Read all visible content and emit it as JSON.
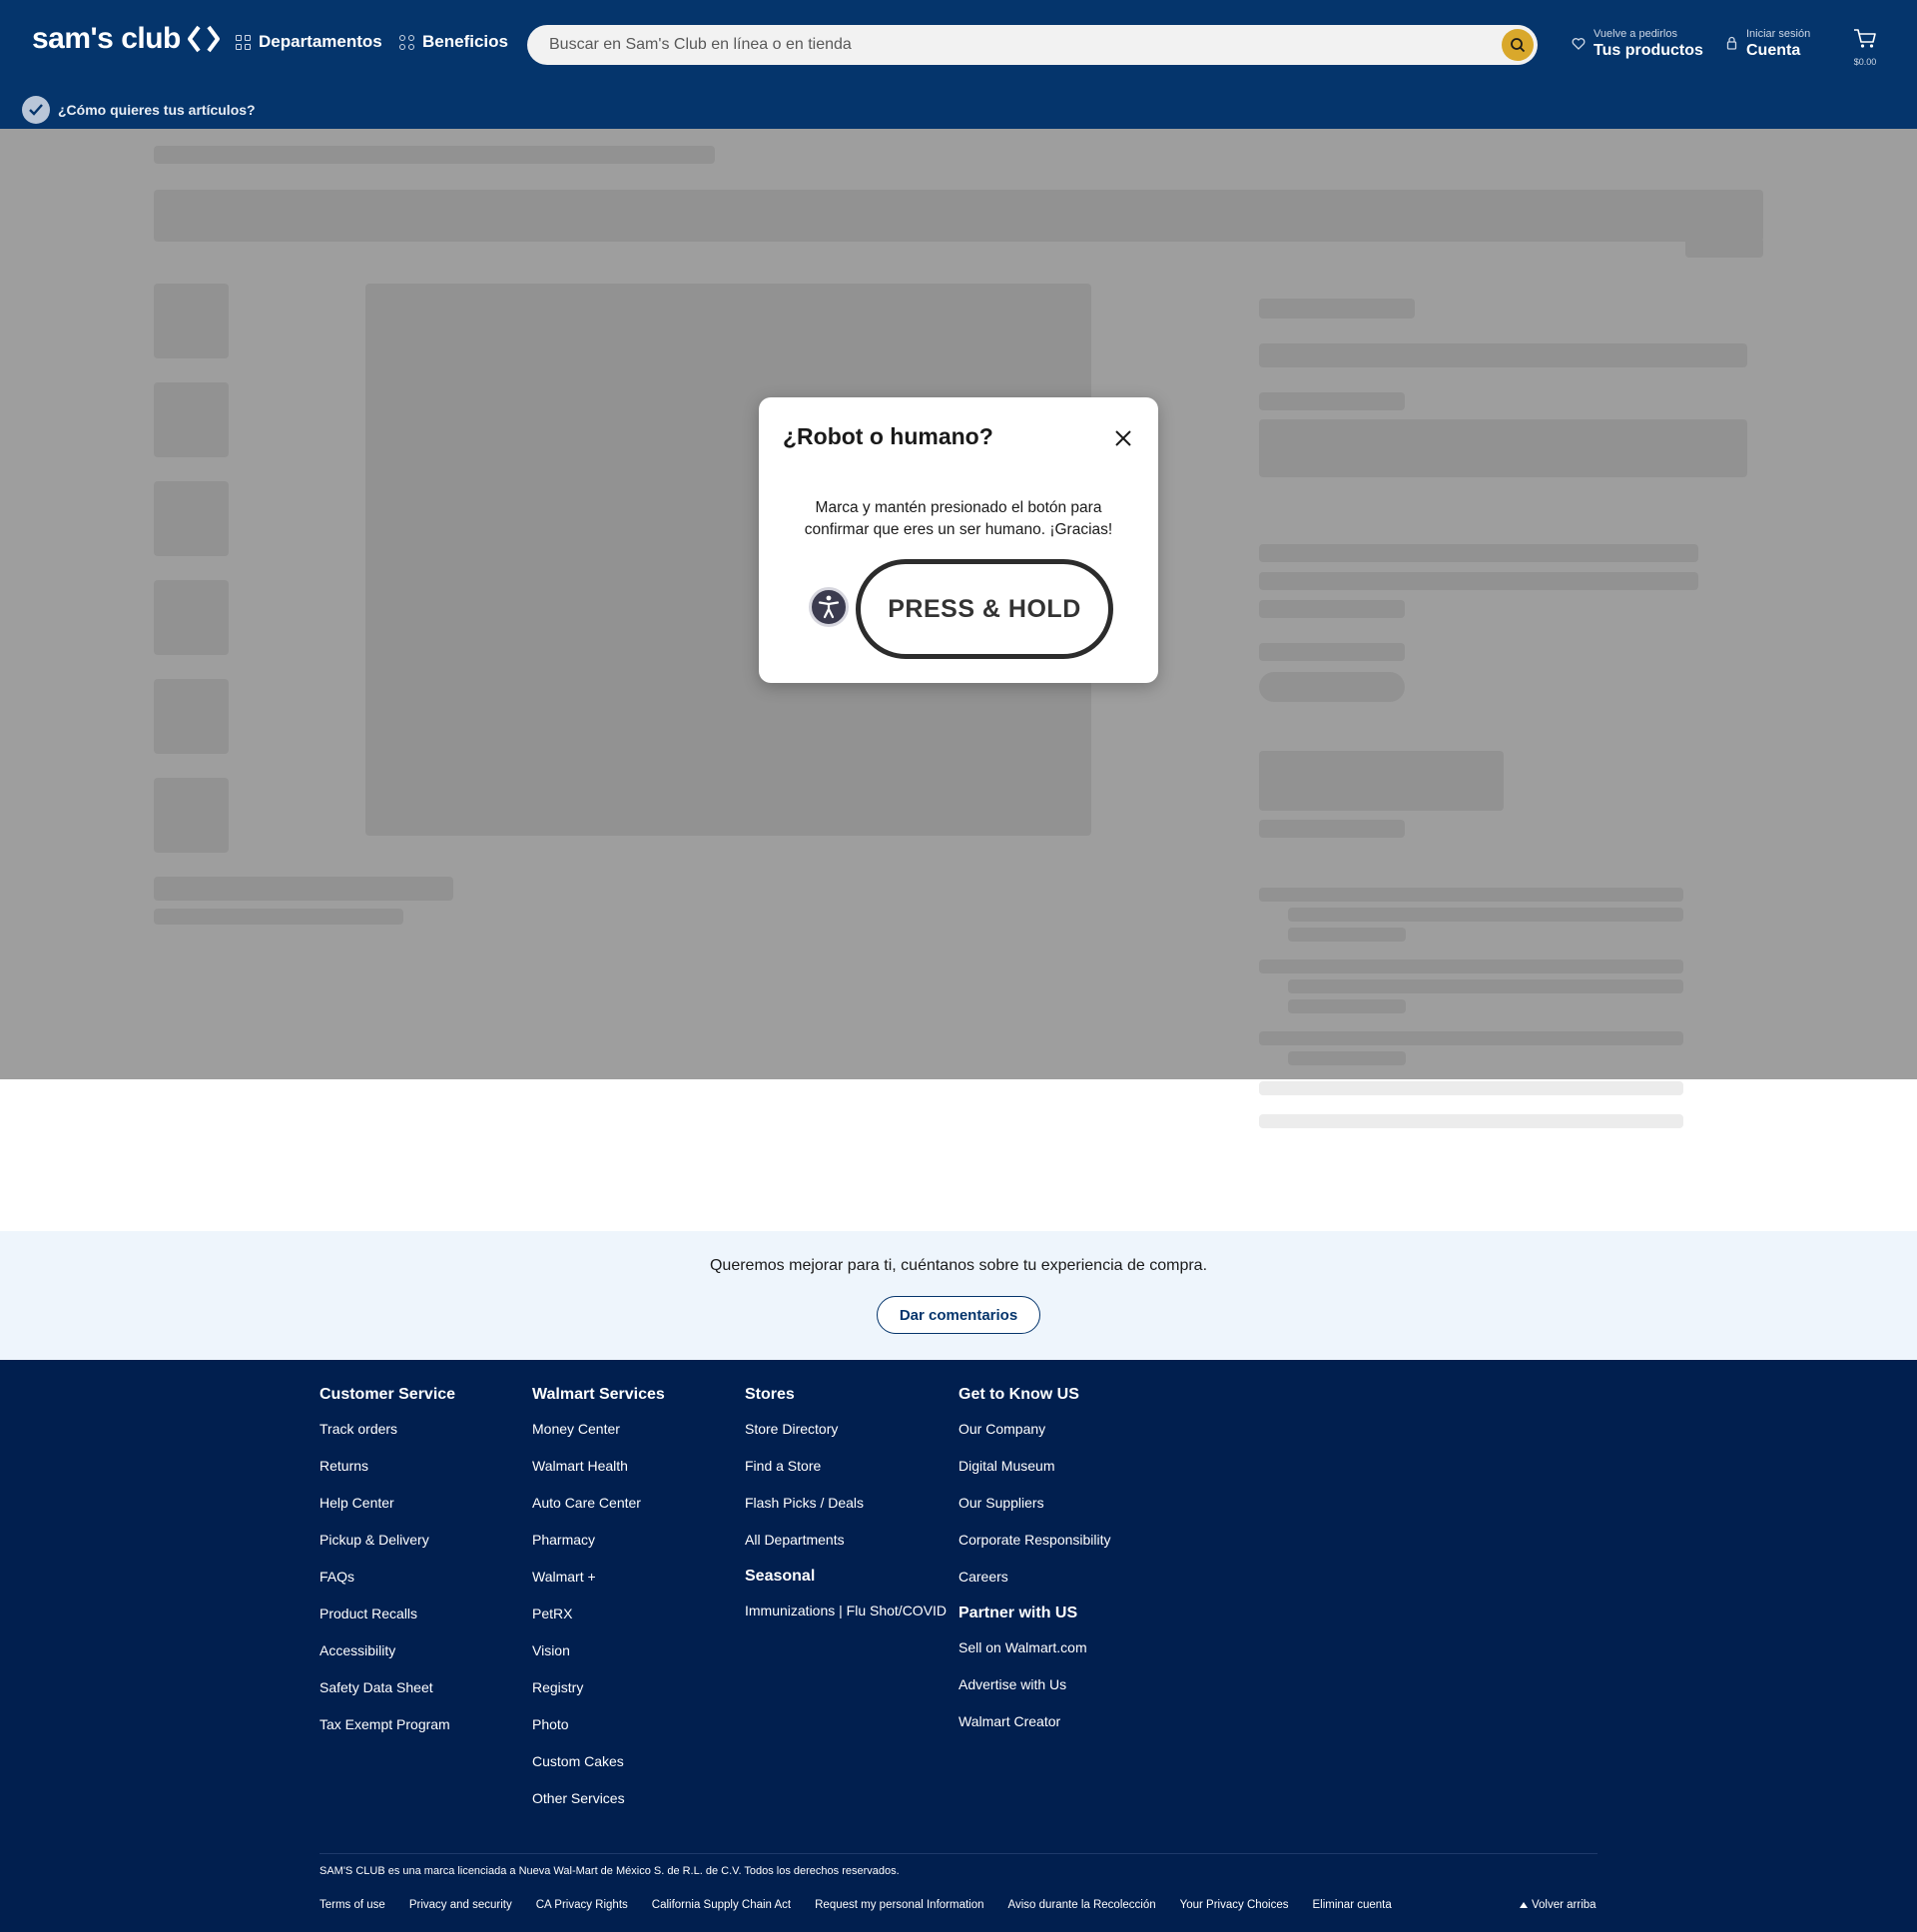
{
  "header": {
    "logo_text": "sam's club",
    "nav": [
      {
        "label": "Departamentos",
        "icon": "grid-icon"
      },
      {
        "label": "Beneficios",
        "icon": "dots-icon"
      }
    ],
    "search": {
      "placeholder": "Buscar en Sam's Club en línea o en tienda",
      "value": ""
    },
    "reorder": {
      "small": "Vuelve a pedirlos",
      "big": "Tus productos",
      "icon": "heart-icon"
    },
    "account": {
      "small": "Iniciar sesión",
      "big": "Cuenta",
      "icon": "user-icon"
    },
    "cart": {
      "amount": "$0.00",
      "icon": "cart-icon"
    },
    "delivery_prompt": "¿Cómo quieres tus artículos?",
    "accent_color": "#05356c",
    "search_button_color": "#d9a82b"
  },
  "modal": {
    "title": "¿Robot o humano?",
    "message": "Marca y mantén presionado el botón para confirmar que eres un ser humano. ¡Gracias!",
    "button_label": "PRESS & HOLD"
  },
  "feedback": {
    "text": "Queremos mejorar para ti, cuéntanos sobre tu experiencia de compra.",
    "button_label": "Dar comentarios"
  },
  "footer": {
    "columns": [
      {
        "heading": "Customer Service",
        "links": [
          "Track orders",
          "Returns",
          "Help Center",
          "Pickup & Delivery",
          "FAQs",
          "Product Recalls",
          "Accessibility",
          "Safety Data Sheet",
          "Tax Exempt Program"
        ]
      },
      {
        "heading": "Walmart Services",
        "links": [
          "Money Center",
          "Walmart Health",
          "Auto Care Center",
          "Pharmacy",
          "Walmart +",
          "PetRX",
          "Vision",
          "Registry",
          "Photo",
          "Custom Cakes",
          "Other Services"
        ]
      },
      {
        "heading": "Stores",
        "links": [
          "Store Directory",
          "Find a Store",
          "Flash Picks / Deals",
          "All Departments"
        ],
        "sub_heading": "Seasonal",
        "sub_links": [
          "Immunizations | Flu Shot/COVID"
        ]
      },
      {
        "heading": "Get to Know US",
        "links": [
          "Our Company",
          "Digital Museum",
          "Our Suppliers",
          "Corporate Responsibility",
          "Careers"
        ],
        "sub_heading": "Partner with US",
        "sub_links": [
          "Sell on Walmart.com",
          "Advertise with Us",
          "Walmart Creator"
        ]
      }
    ],
    "copyright": "SAM'S CLUB es una marca licenciada a Nueva Wal-Mart de México S. de R.L. de C.V. Todos los derechos reservados.",
    "legal_links": [
      "Terms of use",
      "Privacy and security",
      "CA Privacy Rights",
      "California Supply Chain Act",
      "Request my personal Information",
      "Aviso durante la Recolección",
      "Your Privacy Choices",
      "Eliminar cuenta"
    ],
    "back_to_top": "Volver arriba"
  }
}
